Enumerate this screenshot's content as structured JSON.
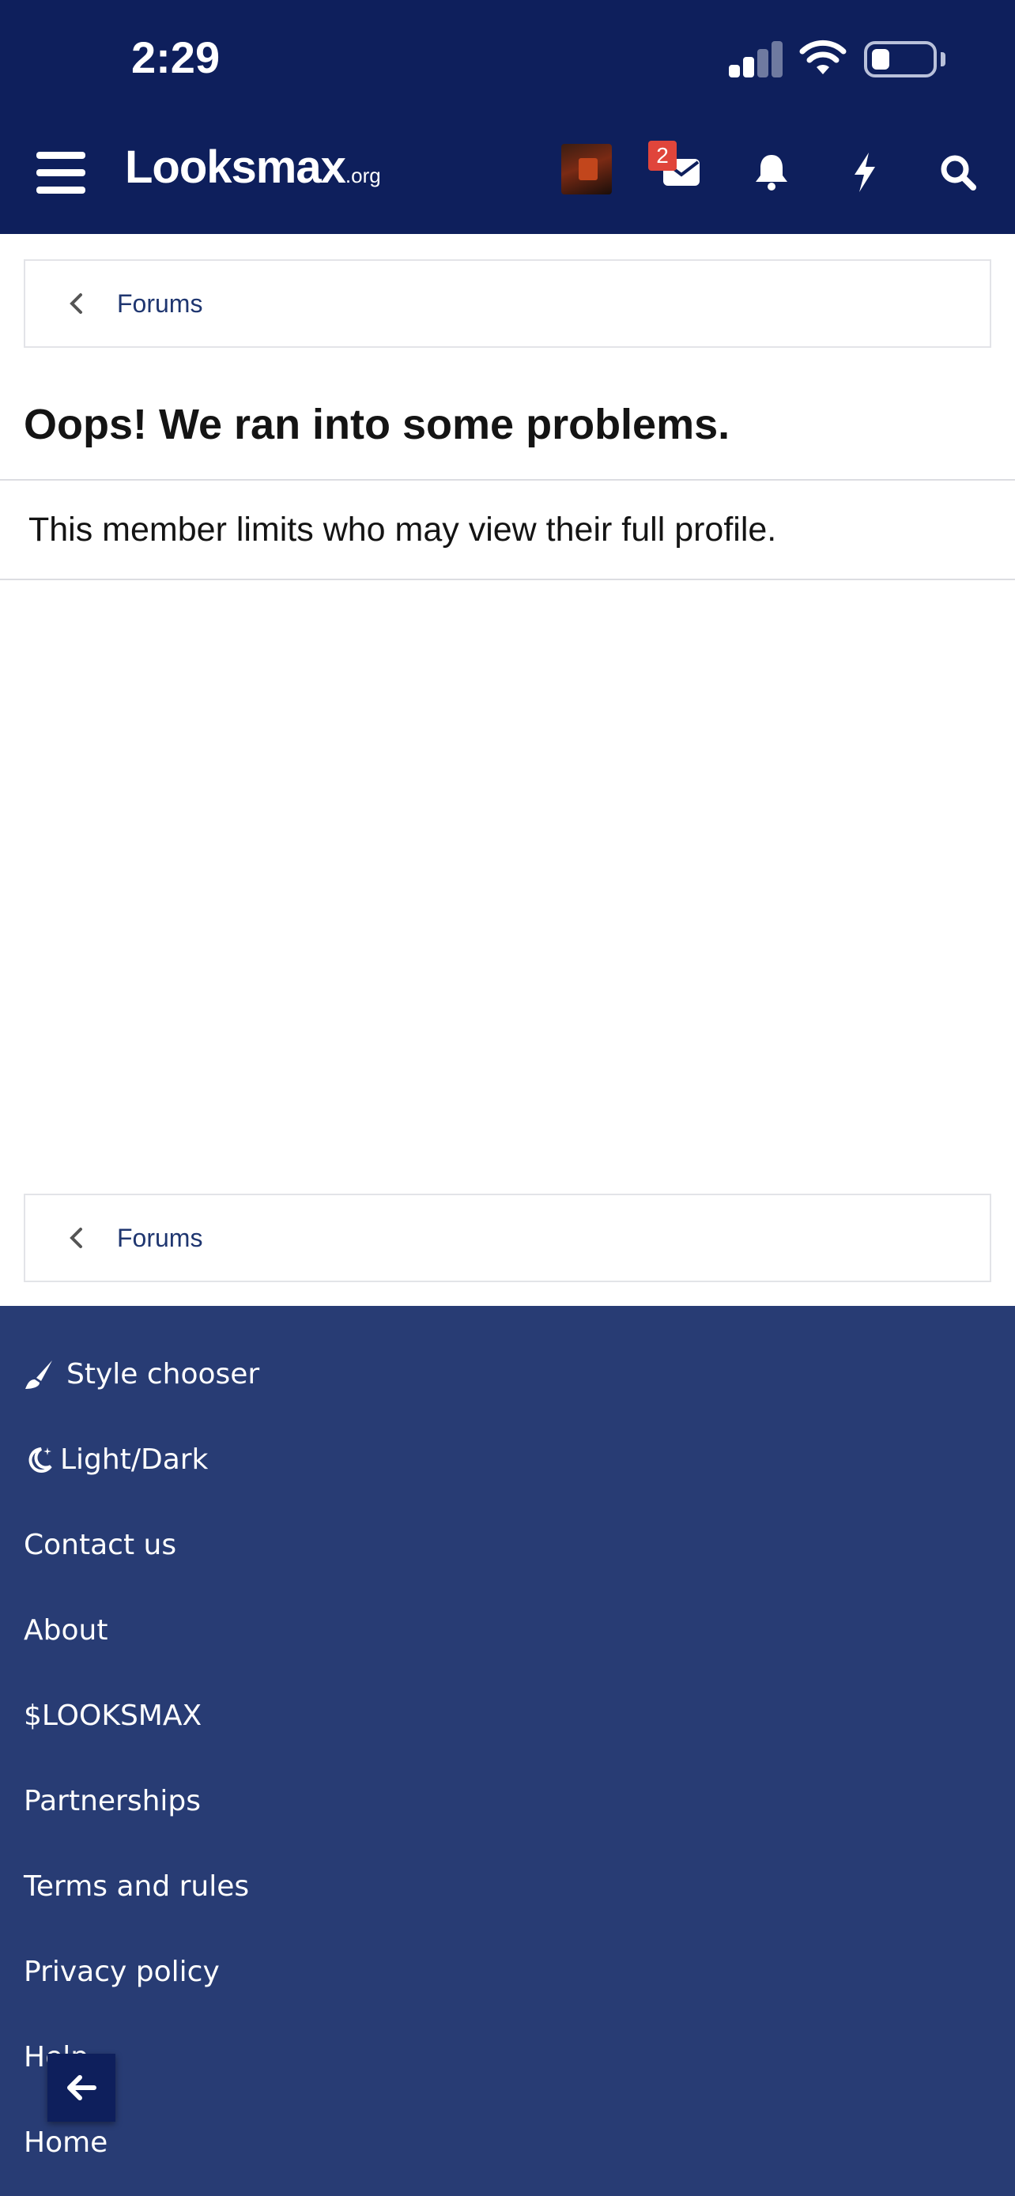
{
  "status_bar": {
    "time": "2:29"
  },
  "header": {
    "logo": "Looksmax",
    "logo_suffix": ".org",
    "messages_badge": "2",
    "icons": [
      "menu-icon",
      "avatar",
      "envelope-icon",
      "bell-icon",
      "bolt-icon",
      "search-icon"
    ]
  },
  "breadcrumb_top": {
    "label": "Forums"
  },
  "error": {
    "title": "Oops! We ran into some problems.",
    "message": "This member limits who may view their full profile."
  },
  "breadcrumb_bottom": {
    "label": "Forums"
  },
  "footer": {
    "items": [
      {
        "label": "Style chooser",
        "icon": "paintbrush-icon"
      },
      {
        "label": "Light/Dark",
        "icon": "moon-icon"
      },
      {
        "label": "Contact us"
      },
      {
        "label": "About"
      },
      {
        "label": "$LOOKSMAX"
      },
      {
        "label": "Partnerships"
      },
      {
        "label": "Terms and rules"
      },
      {
        "label": "Privacy policy"
      },
      {
        "label": "Help"
      },
      {
        "label": "Home"
      }
    ]
  },
  "colors": {
    "header_bg": "#0e1f5c",
    "footer_bg": "#283c74",
    "link": "#1f3670",
    "badge": "#e0453b"
  }
}
